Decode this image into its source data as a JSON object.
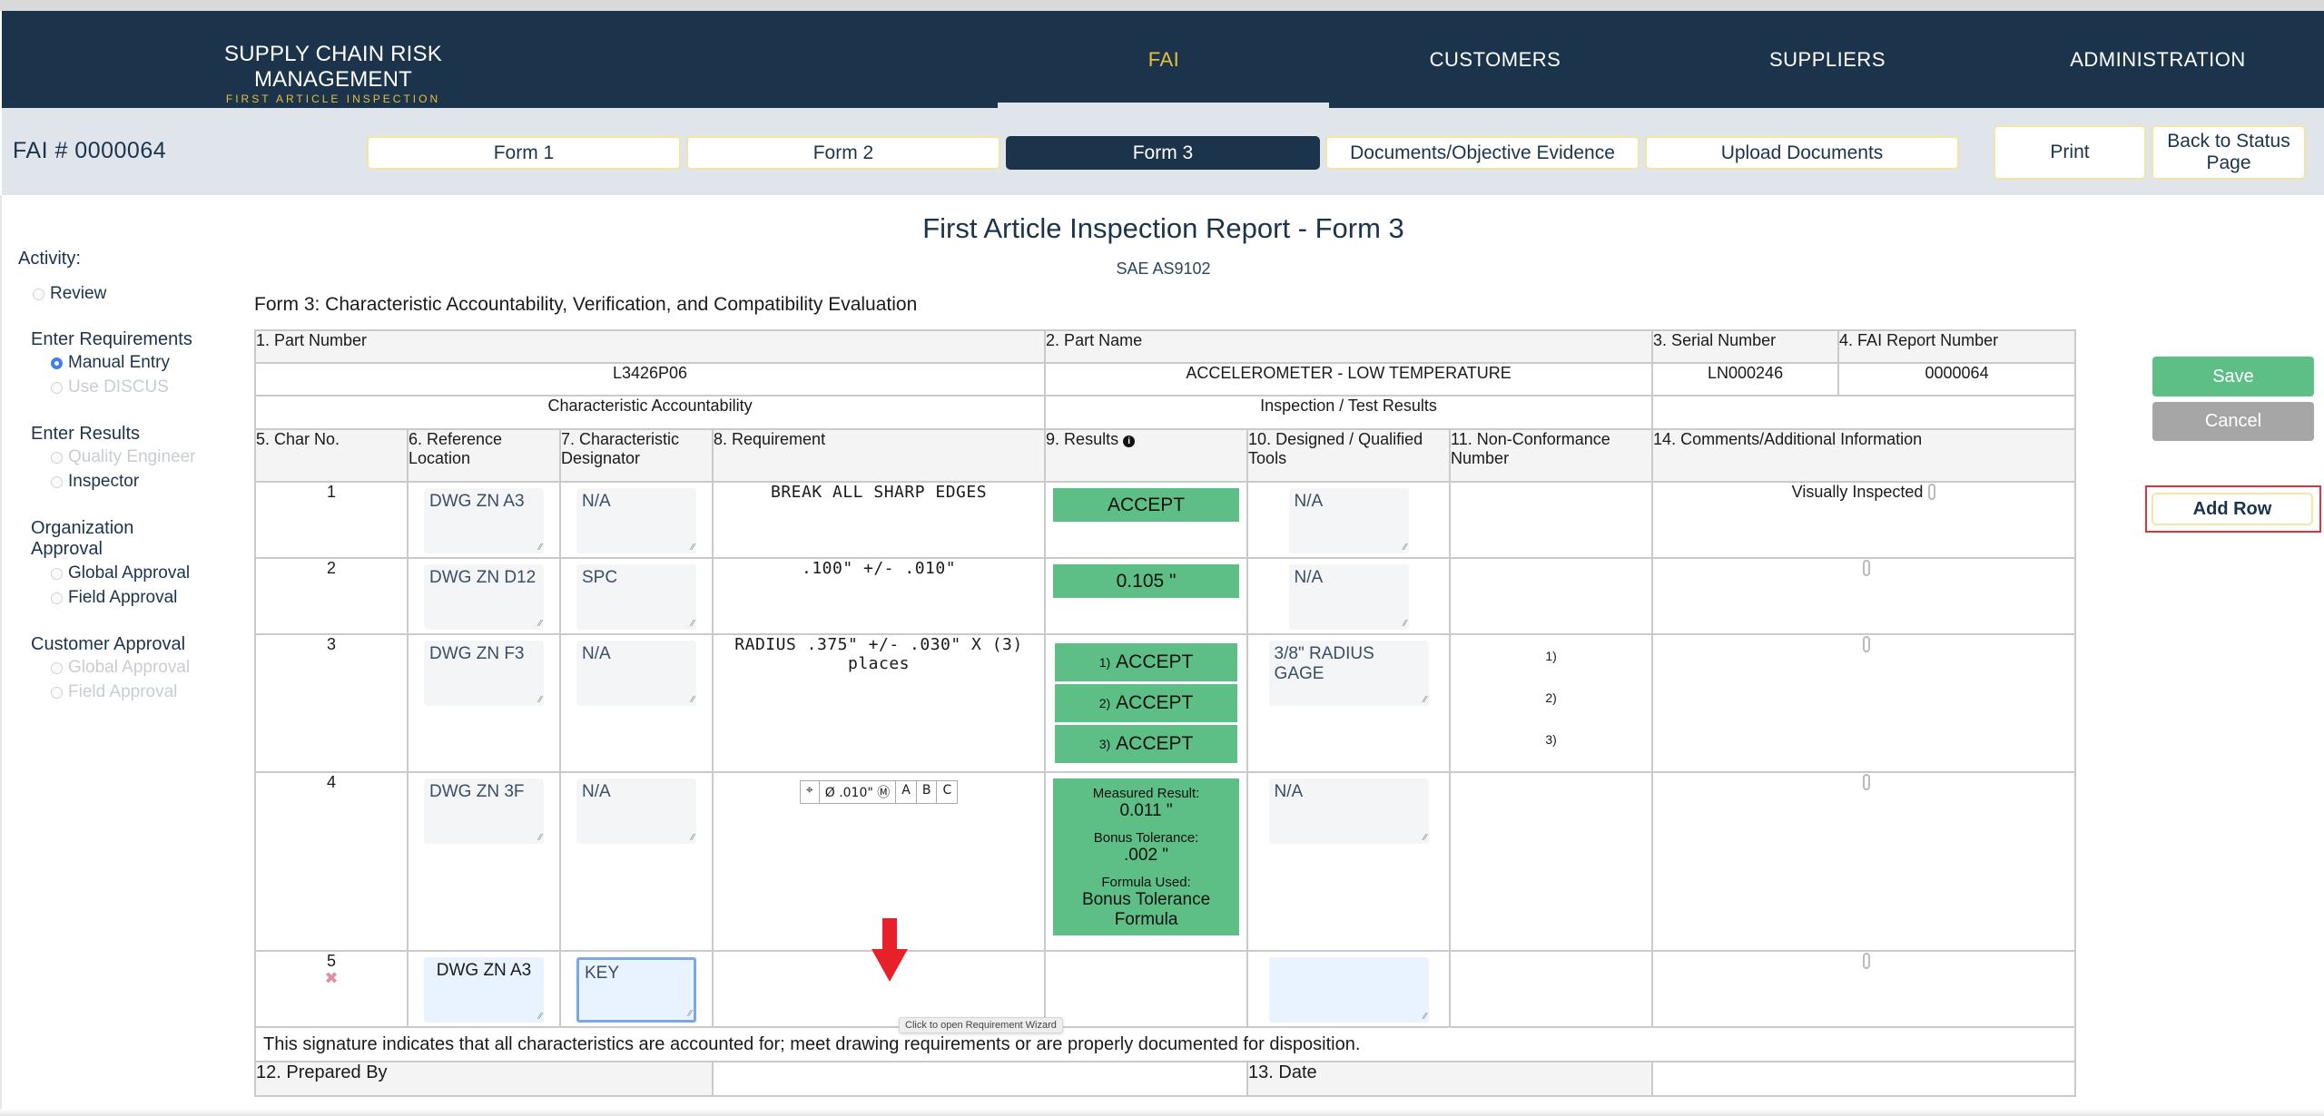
{
  "app": {
    "brand_title": "SUPPLY CHAIN RISK MANAGEMENT",
    "brand_subtitle": "FIRST ARTICLE INSPECTION"
  },
  "nav": {
    "items": [
      {
        "label": "FAI",
        "active": true
      },
      {
        "label": "CUSTOMERS",
        "active": false
      },
      {
        "label": "SUPPLIERS",
        "active": false
      },
      {
        "label": "ADMINISTRATION",
        "active": false
      }
    ]
  },
  "subheader": {
    "fai_number": "FAI # 0000064",
    "tabs": [
      {
        "label": "Form 1",
        "active": false
      },
      {
        "label": "Form 2",
        "active": false
      },
      {
        "label": "Form 3",
        "active": true
      },
      {
        "label": "Documents/Objective Evidence",
        "active": false
      },
      {
        "label": "Upload Documents",
        "active": false
      }
    ],
    "print_label": "Print",
    "back_label": "Back to Status Page"
  },
  "sidebar": {
    "activity_label": "Activity:",
    "review_label": "Review",
    "enter_requirements": {
      "heading": "Enter Requirements",
      "options": [
        {
          "label": "Manual Entry",
          "checked": true,
          "disabled": false
        },
        {
          "label": "Use DISCUS",
          "checked": false,
          "disabled": true
        }
      ]
    },
    "enter_results": {
      "heading": "Enter Results",
      "options": [
        {
          "label": "Quality Engineer",
          "checked": false,
          "disabled": true
        },
        {
          "label": "Inspector",
          "checked": false,
          "disabled": false
        }
      ]
    },
    "organization_approval": {
      "heading_line1": "Organization",
      "heading_line2": "Approval",
      "options": [
        {
          "label": "Global Approval",
          "checked": false,
          "disabled": false
        },
        {
          "label": "Field Approval",
          "checked": false,
          "disabled": false
        }
      ]
    },
    "customer_approval": {
      "heading": "Customer Approval",
      "options": [
        {
          "label": "Global Approval",
          "checked": false,
          "disabled": true
        },
        {
          "label": "Field Approval",
          "checked": false,
          "disabled": true
        }
      ]
    }
  },
  "page": {
    "title": "First Article Inspection Report - Form 3",
    "subtitle": "SAE AS9102",
    "form_caption": "Form 3: Characteristic Accountability, Verification, and Compatibility Evaluation"
  },
  "form": {
    "headers": {
      "part_number": "1. Part Number",
      "part_name": "2. Part Name",
      "serial_number": "3. Serial Number",
      "fai_report_number": "4. FAI Report Number",
      "char_accountability": "Characteristic Accountability",
      "inspection_results": "Inspection / Test Results",
      "char_no": "5. Char No.",
      "ref_location": "6. Reference Location",
      "char_designator": "7. Characteristic Designator",
      "requirement": "8. Requirement",
      "results": "9. Results",
      "tools": "10. Designed / Qualified Tools",
      "nonconformance": "11. Non-Conformance Number",
      "comments": "14. Comments/Additional Information",
      "prepared_by": "12. Prepared By",
      "date": "13. Date"
    },
    "values": {
      "part_number": "L3426P06",
      "part_name": "ACCELEROMETER - LOW TEMPERATURE",
      "serial_number": "LN000246",
      "fai_report_number": "0000064"
    },
    "rows": [
      {
        "char_no": "1",
        "ref_location": "DWG ZN A3",
        "designator": "N/A",
        "requirement": "BREAK  ALL  SHARP  EDGES",
        "result": "ACCEPT",
        "tools": "N/A",
        "comment": "Visually Inspected"
      },
      {
        "char_no": "2",
        "ref_location": "DWG ZN D12",
        "designator": "SPC",
        "requirement": ".100\"  +/-  .010\"",
        "result": "0.105 \"",
        "tools": "N/A",
        "comment": ""
      },
      {
        "char_no": "3",
        "ref_location": "DWG ZN F3",
        "designator": "N/A",
        "requirement": "RADIUS  .375\"  +/-  .030\"  X  (3)  places",
        "results": [
          {
            "index": "1)",
            "value": "ACCEPT"
          },
          {
            "index": "2)",
            "value": "ACCEPT"
          },
          {
            "index": "3)",
            "value": "ACCEPT"
          }
        ],
        "tools": "3/8\" RADIUS GAGE",
        "ncr": [
          "1)",
          "2)",
          "3)"
        ],
        "comment": ""
      },
      {
        "char_no": "4",
        "ref_location": "DWG ZN 3F",
        "designator": "N/A",
        "gdt": {
          "symbol": "⌖",
          "diameter": "Ø",
          "tolerance": ".010\"",
          "modifier": "Ⓜ",
          "datums": [
            "A",
            "B",
            "C"
          ]
        },
        "result_detail": {
          "measured_label": "Measured Result:",
          "measured_value": "0.011 \"",
          "bonus_label": "Bonus Tolerance:",
          "bonus_value": ".002 \"",
          "formula_label": "Formula Used:",
          "formula_value": "Bonus Tolerance Formula"
        },
        "tools": "N/A",
        "comment": ""
      },
      {
        "char_no": "5",
        "ref_location": "DWG ZN A3",
        "designator": "KEY",
        "requirement": "",
        "tools": "",
        "comment": ""
      }
    ],
    "signature_text": "This signature indicates that all characteristics are accounted for; meet drawing requirements or are properly documented for disposition.",
    "tooltip": "Click to open Requirement Wizard"
  },
  "actions": {
    "save_label": "Save",
    "cancel_label": "Cancel",
    "add_row_label": "Add Row"
  },
  "colors": {
    "navy": "#1c344b",
    "gold": "#e8bf3d",
    "accept_green": "#5dbf86",
    "highlight_red": "#e0323b"
  }
}
